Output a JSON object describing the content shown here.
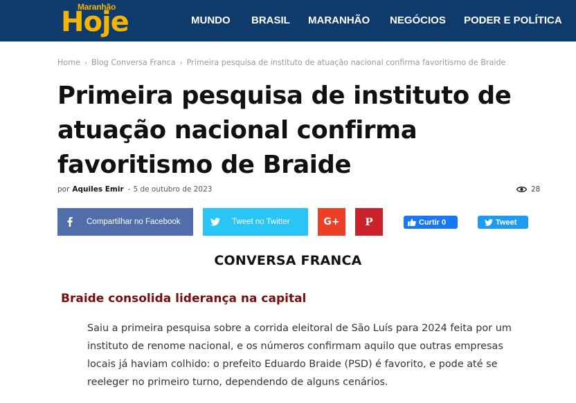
{
  "header": {
    "logo_small": "Maranhão",
    "logo_big": "Hoje",
    "nav": [
      "MUNDO",
      "BRASIL",
      "MARANHÃO",
      "NEGÓCIOS",
      "PODER E POLÍTICA"
    ]
  },
  "breadcrumb": {
    "home": "Home",
    "category": "Blog Conversa Franca",
    "current": "Primeira pesquisa de instituto de atuação nacional confirma favoritismo de Braide"
  },
  "article": {
    "title": "Primeira pesquisa de instituto de atuação nacional confirma favoritismo de Braide",
    "by": "por",
    "author": "Aquiles Emir",
    "dash": "-",
    "date": "5 de outubro de 2023",
    "views": "28"
  },
  "share": {
    "facebook": "Compartilhar no Facebook",
    "twitter": "Tweet no Twitter",
    "like": "Curtir 0",
    "tweet": "Tweet"
  },
  "content": {
    "section": "CONVERSA FRANCA",
    "subhead": "Braide consolida liderança na capital",
    "paragraph": "Saiu a primeira pesquisa sobre a corrida eleitoral de São Luís para 2024 feita por um instituto de renome nacional, e os números confirmam aquilo que outras empresas locais já haviam colhido: o prefeito Eduardo Braide (PSD) é favorito, e pode até se reeleger no primeiro turno, dependendo de alguns cenários."
  },
  "colors": {
    "header_bg": "#0f3b6c",
    "logo": "#f5b400",
    "facebook": "#516eab",
    "twitter": "#29c5f6",
    "googleplus": "#eb4026",
    "pinterest": "#ca212a",
    "subhead": "#7a0d0d"
  }
}
